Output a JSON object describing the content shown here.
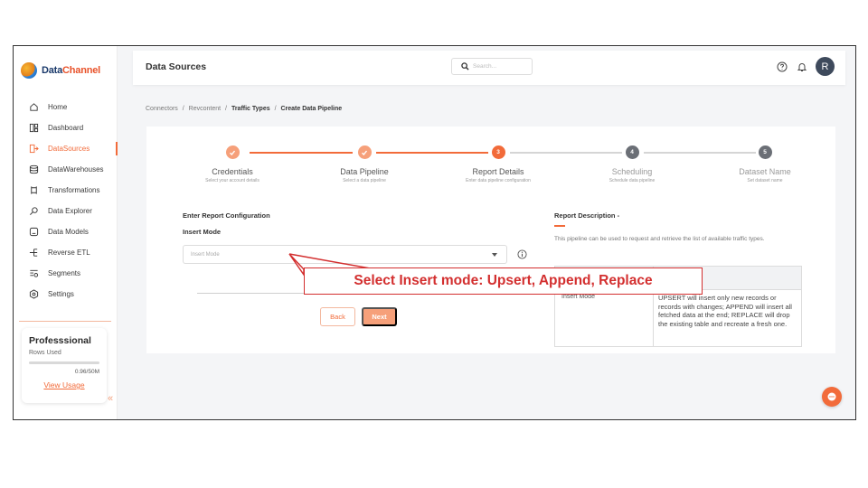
{
  "app": {
    "logo_prefix": "Data",
    "logo_suffix": "Channel"
  },
  "sidebar": {
    "items": [
      {
        "label": "Home",
        "icon": "home-icon"
      },
      {
        "label": "Dashboard",
        "icon": "dashboard-icon"
      },
      {
        "label": "DataSources",
        "icon": "datasources-icon",
        "active": true
      },
      {
        "label": "DataWarehouses",
        "icon": "database-icon"
      },
      {
        "label": "Transformations",
        "icon": "transform-icon"
      },
      {
        "label": "Data Explorer",
        "icon": "explorer-icon"
      },
      {
        "label": "Data Models",
        "icon": "model-icon"
      },
      {
        "label": "Reverse ETL",
        "icon": "reverse-etl-icon"
      },
      {
        "label": "Segments",
        "icon": "segments-icon"
      },
      {
        "label": "Settings",
        "icon": "settings-icon"
      }
    ],
    "plan": {
      "title": "Professsional",
      "rows_label": "Rows Used",
      "rows_value": "0.96/50M",
      "link": "View Usage"
    },
    "collapse_glyph": "«"
  },
  "header": {
    "title": "Data Sources",
    "search_placeholder": "Search...",
    "avatar_initial": "R"
  },
  "breadcrumb": {
    "items": [
      "Connectors",
      "Revcontent",
      "Traffic Types",
      "Create Data Pipeline"
    ],
    "separator": "/"
  },
  "stepper": {
    "steps": [
      {
        "name": "Credentials",
        "sub": "Select your account details",
        "state": "done"
      },
      {
        "name": "Data Pipeline",
        "sub": "Select a data pipeline",
        "state": "done"
      },
      {
        "name": "Report Details",
        "sub": "Enter data pipeline configuration",
        "state": "current",
        "number": "3"
      },
      {
        "name": "Scheduling",
        "sub": "Schedule data pipeline",
        "state": "pending",
        "number": "4"
      },
      {
        "name": "Dataset Name",
        "sub": "Set dataset name",
        "state": "pending",
        "number": "5"
      }
    ],
    "colors": {
      "done": "#f6a07a",
      "current": "#f26b3a",
      "pending": "#6b6f76",
      "line_done": "#f26b3a",
      "line_pending": "#d5d5d5"
    }
  },
  "form": {
    "title": "Enter Report Configuration",
    "insert_mode_label": "Insert Mode",
    "insert_mode_placeholder": "Insert Mode",
    "back_label": "Back",
    "next_label": "Next"
  },
  "description": {
    "title": "Report Description -",
    "text": "This pipeline can be used to request and retrieve the list of available traffic types.",
    "row_label": "Insert Mode",
    "row_text": "UPSERT will insert only new records or records with changes; APPEND will insert all fetched data at the end; REPLACE will drop the existing table and recreate a fresh one."
  },
  "annotation": {
    "text": "Select Insert mode: Upsert, Append, Replace",
    "color": "#d32f2f"
  },
  "colors": {
    "accent": "#f26b3a"
  }
}
